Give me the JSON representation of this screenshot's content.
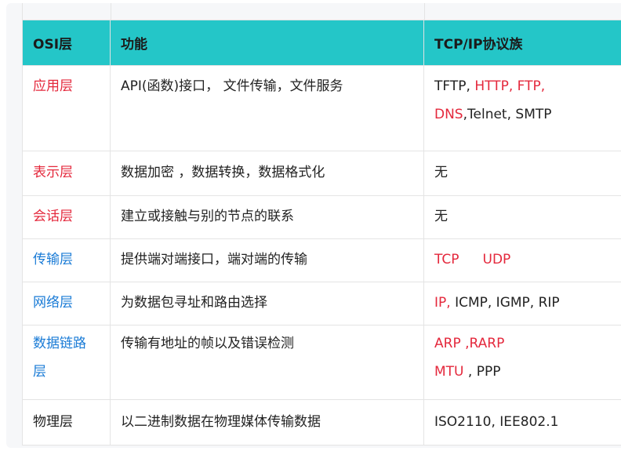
{
  "header": {
    "layer": "OSI层",
    "function": "功能",
    "protocol": "TCP/IP协议族"
  },
  "rows": [
    {
      "layer": "应用层",
      "function": "API(函数)接口， 文件传输，文件服务",
      "p": [
        "TFTP, ",
        "HTTP,",
        " ",
        "FTP,",
        "DNS",
        ",Telnet, SMTP"
      ]
    },
    {
      "layer": "表示层",
      "function": "数据加密 ，数据转换，数据格式化",
      "p": [
        "无"
      ]
    },
    {
      "layer": "会话层",
      "function": "建立或接触与别的节点的联系",
      "p": [
        "无"
      ]
    },
    {
      "layer": "传输层",
      "function": "提供端对端接口，端对端的传输",
      "p": [
        "TCP",
        "UDP"
      ]
    },
    {
      "layer": "网络层",
      "function": "为数据包寻址和路由选择",
      "p": [
        "IP,",
        " ICMP, IGMP, RIP"
      ]
    },
    {
      "layer": "数据链路层",
      "function": "传输有地址的帧以及错误检测",
      "p": [
        "ARP ,RARP",
        "MTU",
        " , PPP"
      ]
    },
    {
      "layer": "物理层",
      "function": "以二进制数据在物理媒体传输数据",
      "p": [
        "ISO2110, IEE802.1"
      ]
    }
  ]
}
